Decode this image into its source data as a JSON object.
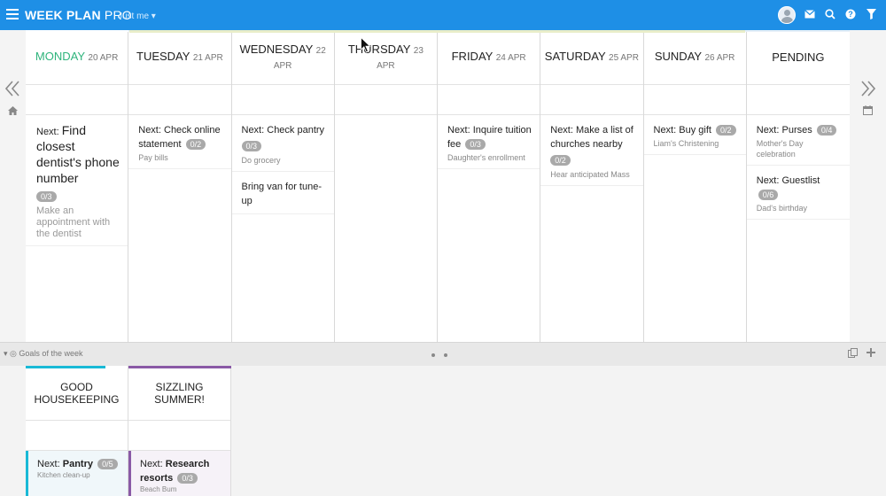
{
  "app": {
    "title_main": "WEEK PLAN",
    "title_pro": "PRO",
    "user_filter": "Just me ▾"
  },
  "icons": {
    "menu": "hamburger-icon",
    "avatar": "user-avatar",
    "mail": "mail-icon",
    "search": "search-icon",
    "help": "help-icon",
    "filter": "filter-icon",
    "prev_week": "double-chevron-left-icon",
    "next_week": "double-chevron-right-icon",
    "home": "home-icon",
    "calendar": "calendar-icon"
  },
  "colors": {
    "topbar": "#1e8fe6",
    "today": "#2fb47c",
    "goal_housekeeping": "#19b9d6",
    "goal_summer": "#8a5aa6"
  },
  "days": [
    {
      "name": "MONDAY",
      "date": "20 APR",
      "today": true
    },
    {
      "name": "TUESDAY",
      "date": "21 APR"
    },
    {
      "name": "WEDNESDAY",
      "date": "22 APR"
    },
    {
      "name": "THURSDAY",
      "date": "23 APR"
    },
    {
      "name": "FRIDAY",
      "date": "24 APR"
    },
    {
      "name": "SATURDAY",
      "date": "25 APR"
    },
    {
      "name": "SUNDAY",
      "date": "26 APR"
    },
    {
      "name": "PENDING",
      "date": ""
    }
  ],
  "tasks": {
    "monday": [
      {
        "prefix": "Next:",
        "title": "Find closest dentist's phone number",
        "badge": "0/3",
        "sub": "Make an appointment with the dentist"
      }
    ],
    "tuesday": [
      {
        "prefix": "Next:",
        "title": "Check online statement",
        "badge": "0/2",
        "sub": "Pay bills"
      }
    ],
    "wednesday": [
      {
        "prefix": "Next:",
        "title": "Check pantry",
        "badge": "0/3",
        "sub": "Do grocery"
      },
      {
        "title": "Bring van for tune-up"
      }
    ],
    "friday": [
      {
        "prefix": "Next:",
        "title": "Inquire tuition fee",
        "badge": "0/3",
        "sub": "Daughter's enrollment"
      }
    ],
    "saturday": [
      {
        "prefix": "Next:",
        "title": "Make a list of churches nearby",
        "badge": "0/2",
        "sub": "Hear anticipated Mass"
      }
    ],
    "sunday": [
      {
        "prefix": "Next:",
        "title": "Buy gift",
        "badge": "0/2",
        "sub": "Liam's Christening"
      }
    ],
    "pending": [
      {
        "prefix": "Next:",
        "title": "Purses",
        "badge": "0/4",
        "sub": "Mother's Day celebration"
      },
      {
        "prefix": "Next:",
        "title": "Guestlist",
        "badge": "0/6",
        "sub": "Dad's birthday"
      }
    ]
  },
  "goals_bar": {
    "label": "Goals of the week"
  },
  "goals": [
    {
      "title": "GOOD HOUSEKEEPING",
      "task_prefix": "Next:",
      "task": "Pantry",
      "badge": "0/5",
      "sub": "Kitchen clean-up"
    },
    {
      "title": "SIZZLING SUMMER!",
      "task_prefix": "Next:",
      "task": "Research resorts",
      "badge": "0/3",
      "sub": "Beach Bum"
    }
  ]
}
